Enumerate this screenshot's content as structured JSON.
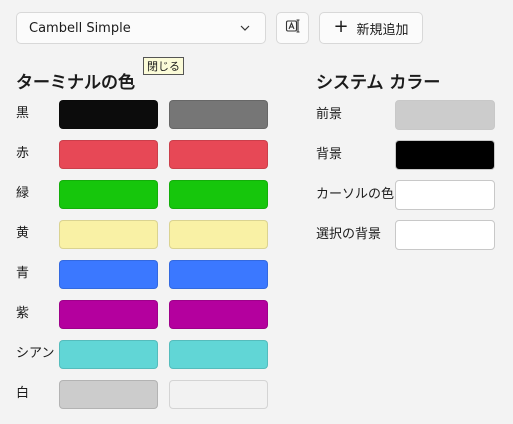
{
  "toolbar": {
    "scheme_name": "Cambell Simple",
    "add_new_label": "新規追加",
    "tooltip": "閉じる"
  },
  "terminal_colors": {
    "title": "ターミナルの色",
    "rows": [
      {
        "label": "黒",
        "normal": "#0c0c0c",
        "bright": "#767676"
      },
      {
        "label": "赤",
        "normal": "#e74856",
        "bright": "#e74856"
      },
      {
        "label": "緑",
        "normal": "#16c60c",
        "bright": "#16c60c"
      },
      {
        "label": "黄",
        "normal": "#f9f1a5",
        "bright": "#f9f1a5"
      },
      {
        "label": "青",
        "normal": "#3b78ff",
        "bright": "#3b78ff"
      },
      {
        "label": "紫",
        "normal": "#b4009e",
        "bright": "#b4009e"
      },
      {
        "label": "シアン",
        "normal": "#61d6d6",
        "bright": "#61d6d6"
      },
      {
        "label": "白",
        "normal": "#cccccc",
        "bright": "#f2f2f2"
      }
    ]
  },
  "system_colors": {
    "title": "システム カラー",
    "rows": [
      {
        "label": "前景",
        "color": "#cccccc"
      },
      {
        "label": "背景",
        "color": "#000000"
      },
      {
        "label": "カーソルの色",
        "color": "#ffffff"
      },
      {
        "label": "選択の背景",
        "color": "#ffffff"
      }
    ]
  }
}
